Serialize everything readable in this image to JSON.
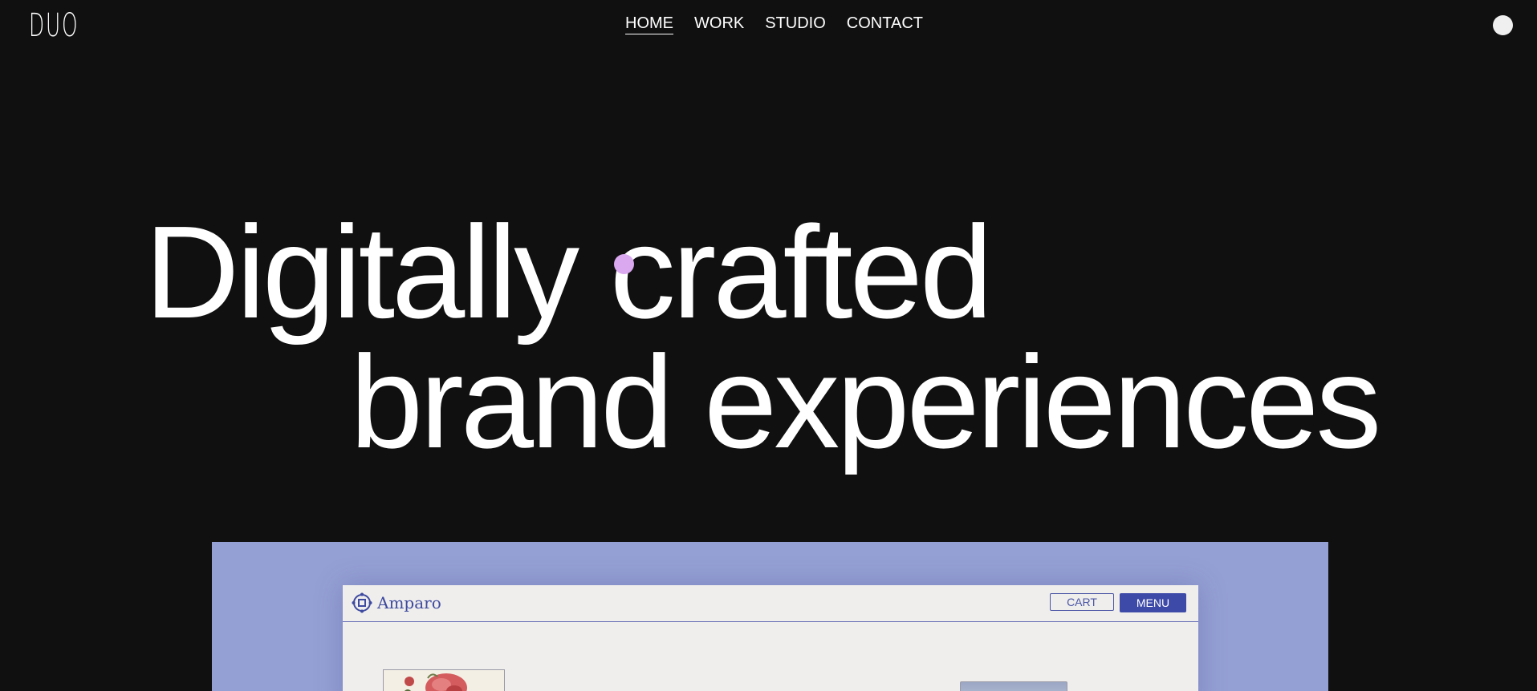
{
  "brand": {
    "logo_text": "DUO"
  },
  "nav": {
    "items": [
      {
        "label": "HOME",
        "active": true
      },
      {
        "label": "WORK",
        "active": false
      },
      {
        "label": "STUDIO",
        "active": false
      },
      {
        "label": "CONTACT",
        "active": false
      }
    ]
  },
  "hero": {
    "line1": "Digitally crafted",
    "line2": "brand experiences"
  },
  "colors": {
    "background": "#111011",
    "text": "#ffffff",
    "cursor_dot": "#d9a8ef",
    "showcase_bg": "#949fd3",
    "mock_accent": "#3d4aa8"
  },
  "showcase": {
    "mock_brand": "Amparo",
    "cart_label": "CART",
    "menu_label": "MENU",
    "logo_icon": "ornament-icon"
  },
  "icons": {
    "theme_toggle": "circle-icon",
    "cursor": "cursor-dot-icon"
  }
}
